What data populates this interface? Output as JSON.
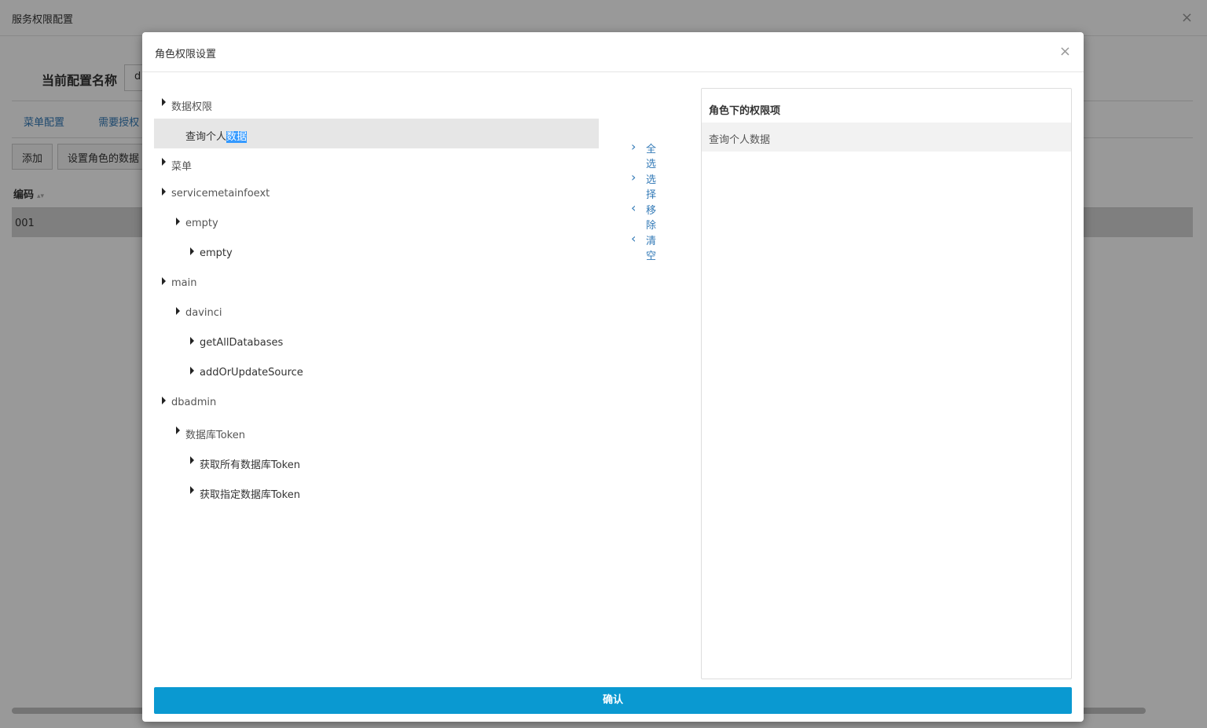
{
  "background": {
    "window_title": "服务权限配置",
    "close_glyph": "×",
    "config_name_label": "当前配置名称",
    "config_name_value": "d",
    "tabs": [
      {
        "label": "菜单配置"
      },
      {
        "label": "需要授权"
      }
    ],
    "buttons": {
      "add_label": "添加",
      "set_role_label": "设置角色的数据"
    },
    "table": {
      "header_code": "编码",
      "sort_glyph": "▴▾",
      "rows": [
        {
          "code": "001"
        }
      ]
    }
  },
  "modal": {
    "title": "角色权限设置",
    "close_glyph": "×",
    "tree": [
      {
        "label": "数据权限"
      },
      {
        "label_prefix": "查询个人",
        "label_highlight": "数据"
      },
      {
        "label": "菜单"
      },
      {
        "label": "servicemetainfoext"
      },
      {
        "label": "empty"
      },
      {
        "label": "empty"
      },
      {
        "label": "main"
      },
      {
        "label": "davinci"
      },
      {
        "label": "getAllDatabases"
      },
      {
        "label": "addOrUpdateSource"
      },
      {
        "label": "dbadmin"
      },
      {
        "label": "数据库Token"
      },
      {
        "label": "获取所有数据库Token"
      },
      {
        "label": "获取指定数据库Token"
      }
    ],
    "actions": [
      {
        "label": "全选",
        "icon": "chevron-right-icon",
        "glyph": "›"
      },
      {
        "label": "选择",
        "icon": "chevron-right-icon",
        "glyph": "›"
      },
      {
        "label": "移除",
        "icon": "chevron-left-icon",
        "glyph": "‹"
      },
      {
        "label": "清空",
        "icon": "chevron-left-icon",
        "glyph": "‹"
      }
    ],
    "right_panel": {
      "title": "角色下的权限项",
      "items": [
        {
          "label": "查询个人数据"
        }
      ]
    },
    "confirm_label": "确认"
  },
  "colors": {
    "accent": "#0a99d1",
    "link": "#337ab7",
    "selection_highlight": "#3399ff",
    "selected_row": "#e6e6e6"
  }
}
